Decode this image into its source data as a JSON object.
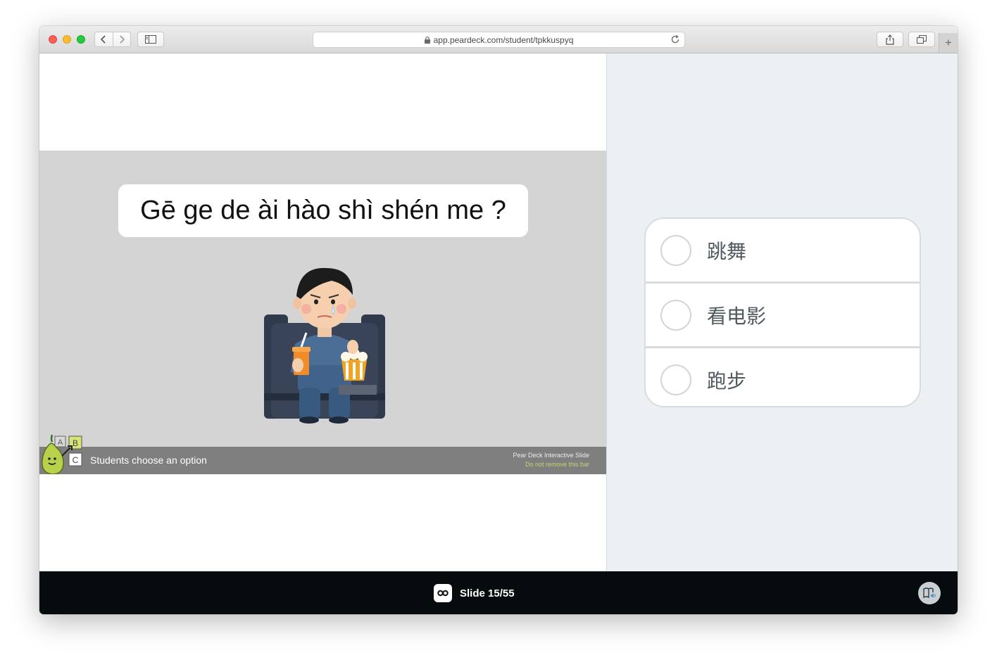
{
  "browser": {
    "url": "app.peardeck.com/student/tpkkuspyq",
    "new_tab_label": "+"
  },
  "slide": {
    "question": "Gē ge de ài hào shì shén me ?",
    "bar_label": "Students choose an option",
    "bar_right_title": "Pear Deck Interactive Slide",
    "bar_right_note": "Do not remove this bar",
    "logo_letters": [
      "A",
      "B",
      "C"
    ]
  },
  "options": [
    {
      "label": "跳舞",
      "selected": false
    },
    {
      "label": "看电影",
      "selected": false
    },
    {
      "label": "跑步",
      "selected": false
    }
  ],
  "footer": {
    "slide_label": "Slide 15/55"
  },
  "colors": {
    "slide_bg": "#d4d4d4",
    "slide_bar": "#7f7f7f",
    "right_pane": "#ecf0f3",
    "footer": "#060b0d",
    "option_text": "#4f5a5e"
  },
  "icons": [
    "back-icon",
    "forward-icon",
    "sidebar-icon",
    "lock-icon",
    "reload-icon",
    "share-icon",
    "tabs-icon",
    "pear-deck-icon",
    "immersive-reader-icon"
  ]
}
